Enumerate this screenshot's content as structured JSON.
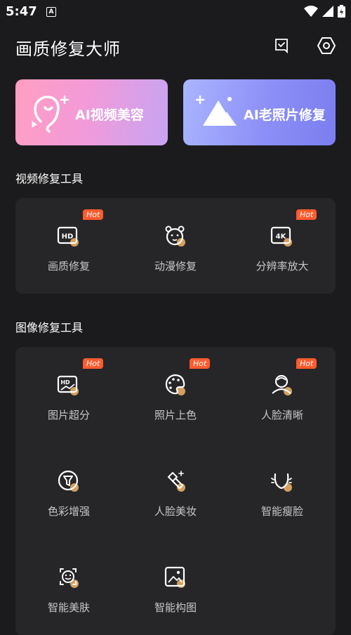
{
  "status": {
    "time": "5:47",
    "notification_letter": "A"
  },
  "header": {
    "title": "画质修复大师",
    "left_icon": "message-icon",
    "right_icon": "settings-icon"
  },
  "banners": [
    {
      "label": "AI视频美容",
      "icon": "face-sparkle-icon",
      "gradient": [
        "#ff9fc0",
        "#c7a4f2"
      ]
    },
    {
      "label": "AI老照片修复",
      "icon": "mountain-sparkle-icon",
      "gradient": [
        "#a9b5ff",
        "#7a7eef"
      ]
    }
  ],
  "video_section": {
    "title": "视频修复工具",
    "tools": [
      {
        "label": "画质修复",
        "hot": "Hot",
        "icon": "hd-icon"
      },
      {
        "label": "动漫修复",
        "hot": "",
        "icon": "bear-face-icon"
      },
      {
        "label": "分辨率放大",
        "hot": "Hot",
        "icon": "4k-icon"
      }
    ]
  },
  "image_section": {
    "title": "图像修复工具",
    "tools": [
      {
        "label": "图片超分",
        "hot": "Hot",
        "icon": "hd-image-icon"
      },
      {
        "label": "照片上色",
        "hot": "Hot",
        "icon": "palette-icon"
      },
      {
        "label": "人脸清晰",
        "hot": "Hot",
        "icon": "portrait-icon"
      },
      {
        "label": "色彩增强",
        "hot": "",
        "icon": "filter-icon"
      },
      {
        "label": "人脸美妆",
        "hot": "",
        "icon": "lipstick-icon"
      },
      {
        "label": "智能瘦脸",
        "hot": "",
        "icon": "face-contour-icon"
      },
      {
        "label": "智能美肤",
        "hot": "",
        "icon": "smile-face-icon"
      },
      {
        "label": "智能构图",
        "hot": "",
        "icon": "image-frame-icon"
      }
    ]
  },
  "colors": {
    "background": "#1b1b1d",
    "card": "#262628",
    "hot_badge": "#ff5b2e",
    "icon_accent": "#f5b56a"
  }
}
